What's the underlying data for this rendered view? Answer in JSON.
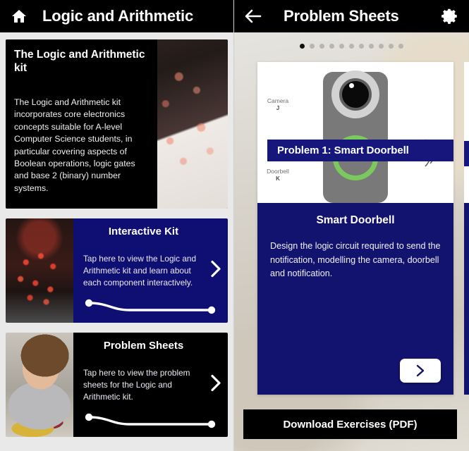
{
  "left_panel": {
    "topbar": {
      "home_icon": "home-icon",
      "title": "Logic and Arithmetic"
    },
    "hero": {
      "title": "The Logic and Arithmetic kit",
      "body": "The Logic and Arithmetic kit incorporates core electronics concepts suitable for A-level Computer Science students, in particular covering aspects of Boolean operations, logic gates and base 2 (binary) number systems."
    },
    "features": [
      {
        "title": "Interactive Kit",
        "body": "Tap here to view the Logic and Arithmetic kit and learn about each component interactively.",
        "chevron_icon": "chevron-right-icon",
        "thumb": "circuit-board-photo",
        "bg": "#0f0f73"
      },
      {
        "title": "Problem Sheets",
        "body": "Tap here to view the problem sheets for the Logic and Arithmetic kit.",
        "chevron_icon": "chevron-right-icon",
        "thumb": "student-with-kit-photo",
        "bg": "#000000"
      }
    ]
  },
  "right_panel": {
    "topbar": {
      "back_icon": "arrow-left-icon",
      "title": "Problem Sheets",
      "settings_icon": "gear-icon"
    },
    "carousel": {
      "total_dots": 11,
      "active_index": 0
    },
    "slide": {
      "banner": "Problem 1: Smart Doorbell",
      "illustration": {
        "name": "smart-doorbell-illustration",
        "labels": [
          {
            "name": "Camera",
            "variable": "J"
          },
          {
            "name": "Doorbell",
            "variable": "K"
          }
        ],
        "ring_color": "#7bc95c",
        "body_color": "#797979"
      },
      "title": "Smart Doorbell",
      "description": "Design the logic circuit required to send the notification, modelling the camera, doorbell and notification.",
      "next_icon": "chevron-right-icon"
    },
    "download_button": "Download Exercises (PDF)"
  },
  "colors": {
    "navy": "#12126f",
    "banner_navy": "#16167d",
    "black": "#000000",
    "green": "#7bc95c"
  }
}
